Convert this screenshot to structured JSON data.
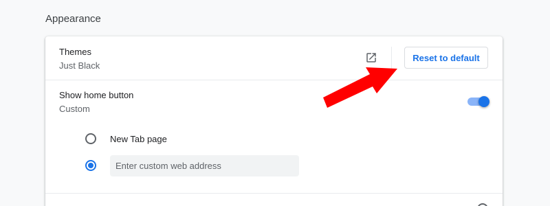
{
  "section": {
    "title": "Appearance"
  },
  "themes": {
    "label": "Themes",
    "value": "Just Black",
    "open_icon": "open-in-new-icon",
    "reset_label": "Reset to default"
  },
  "home_button": {
    "label": "Show home button",
    "value": "Custom",
    "toggle_on": true,
    "options": [
      {
        "label": "New Tab page",
        "selected": false
      },
      {
        "placeholder": "Enter custom web address",
        "selected": true
      }
    ]
  },
  "colors": {
    "accent": "#1a73e8",
    "annotation_arrow": "#ff0000"
  }
}
